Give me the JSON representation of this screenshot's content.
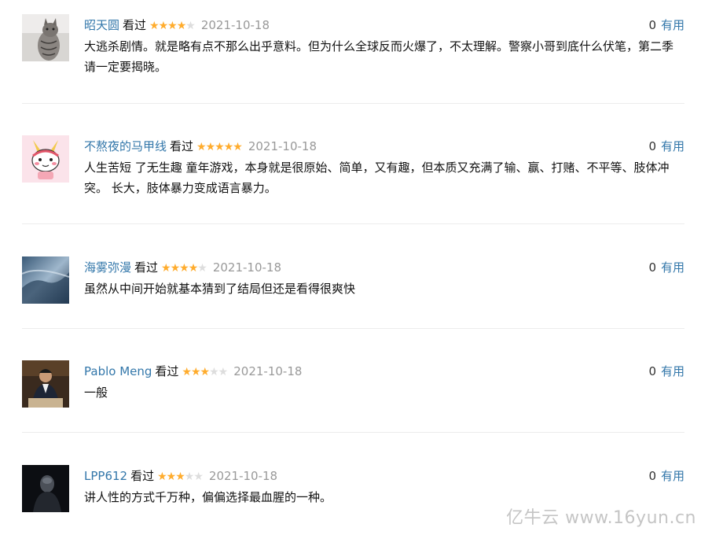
{
  "comments": [
    {
      "user": "昭天圆",
      "watched": "看过",
      "rating": 4,
      "date": "2021-10-18",
      "votes": "0",
      "useful": "有用",
      "text": "大逃杀剧情。就是略有点不那么出乎意料。但为什么全球反而火爆了，不太理解。警察小哥到底什么伏笔，第二季请一定要揭晓。"
    },
    {
      "user": "不熬夜的马甲线",
      "watched": "看过",
      "rating": 5,
      "date": "2021-10-18",
      "votes": "0",
      "useful": "有用",
      "text": "人生苦短 了无生趣 童年游戏，本身就是很原始、简单，又有趣，但本质又充满了输、赢、打赌、不平等、肢体冲突。 长大，肢体暴力变成语言暴力。"
    },
    {
      "user": "海雾弥漫",
      "watched": "看过",
      "rating": 4,
      "date": "2021-10-18",
      "votes": "0",
      "useful": "有用",
      "text": "虽然从中间开始就基本猜到了结局但还是看得很爽快"
    },
    {
      "user": "Pablo Meng",
      "watched": "看过",
      "rating": 3,
      "date": "2021-10-18",
      "votes": "0",
      "useful": "有用",
      "text": "一般"
    },
    {
      "user": "LPP612",
      "watched": "看过",
      "rating": 3,
      "date": "2021-10-18",
      "votes": "0",
      "useful": "有用",
      "text": "讲人性的方式千万种，偏偏选择最血腥的一种。"
    }
  ],
  "watermark": "亿牛云 www.16yun.cn",
  "colors": {
    "link": "#3377aa",
    "star": "#ffac2d",
    "star_off": "#dddddd",
    "date": "#999999",
    "divider": "#ececec"
  }
}
